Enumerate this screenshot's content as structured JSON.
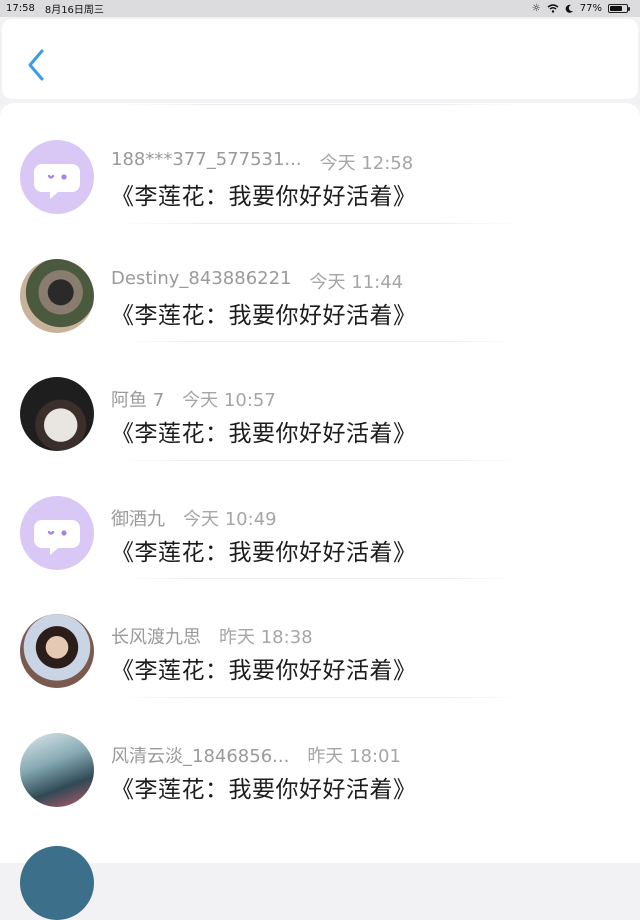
{
  "status": {
    "time": "17:58",
    "date": "8月16日周三",
    "battery": "77%",
    "battery_level": 0.77
  },
  "comments": [
    {
      "user": "188***377_577531...",
      "time": "今天 12:58",
      "text": "《李莲花：我要你好好活着》",
      "avatar": "default"
    },
    {
      "user": "Destiny_843886221",
      "time": "今天 11:44",
      "text": "《李莲花：我要你好好活着》",
      "avatar": "photo"
    },
    {
      "user": "阿鱼 7",
      "time": "今天 10:57",
      "text": "《李莲花：我要你好好活着》",
      "avatar": "photo"
    },
    {
      "user": "御酒九",
      "time": "今天 10:49",
      "text": "《李莲花：我要你好好活着》",
      "avatar": "default"
    },
    {
      "user": "长风渡九思",
      "time": "昨天 18:38",
      "text": "《李莲花：我要你好好活着》",
      "avatar": "photo"
    },
    {
      "user": "风清云淡_1846856...",
      "time": "昨天 18:01",
      "text": "《李莲花：我要你好好活着》",
      "avatar": "photo"
    }
  ],
  "colors": {
    "accent": "#3a9be6",
    "default_avatar_bg": "#d9c8f5",
    "default_avatar_fg": "#a883e3"
  }
}
